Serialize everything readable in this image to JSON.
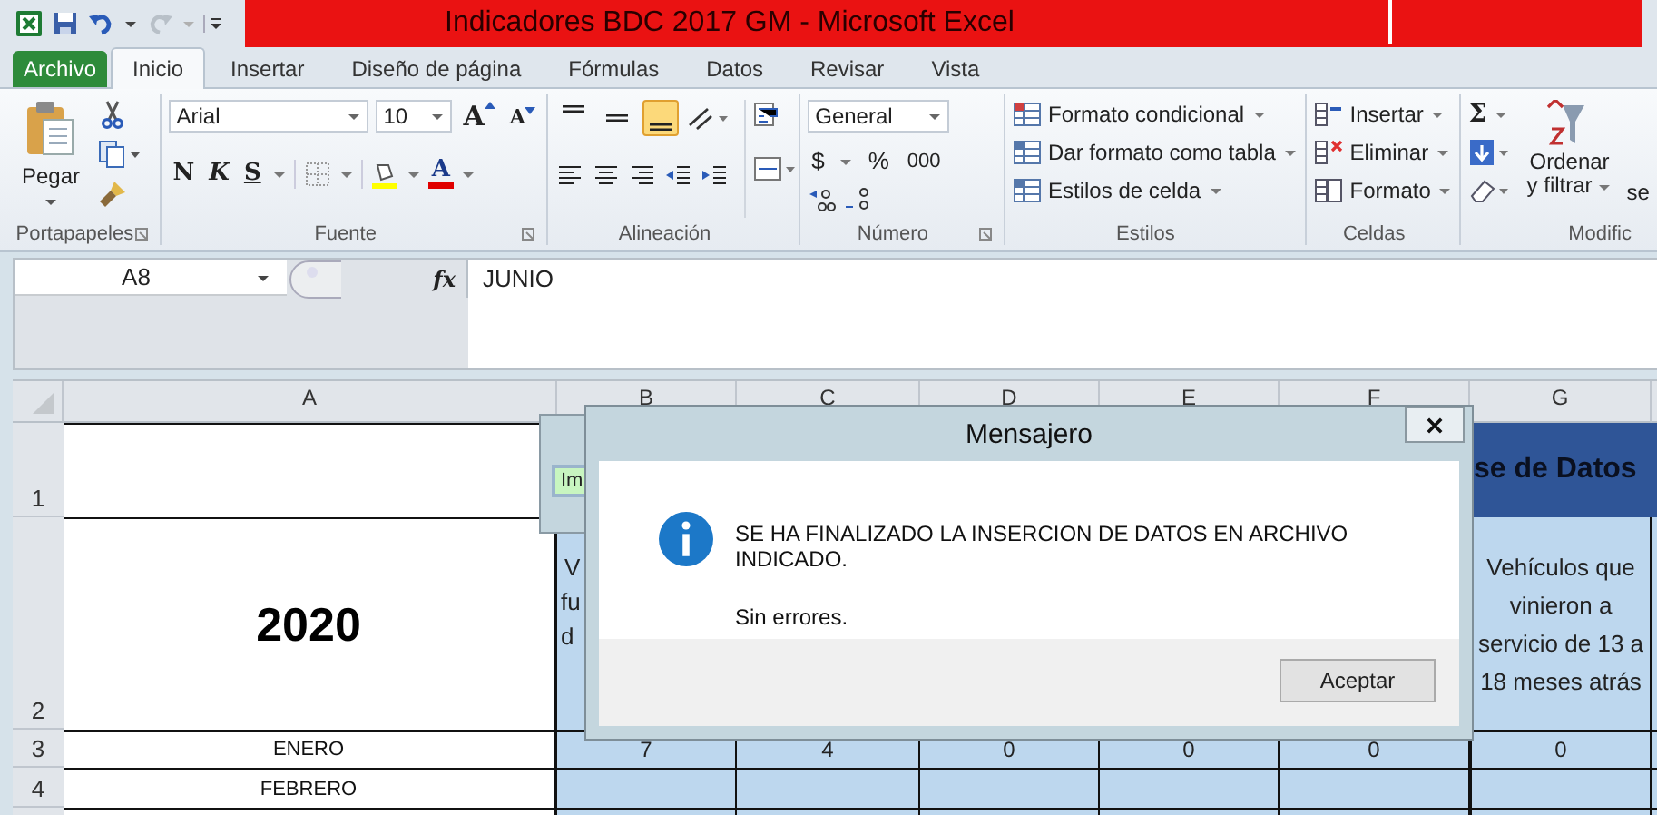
{
  "window": {
    "title": "Indicadores BDC 2017 GM  -  Microsoft Excel"
  },
  "tabs": [
    {
      "label": "Archivo",
      "kind": "file",
      "selected": false
    },
    {
      "label": "Inicio",
      "kind": "tab",
      "selected": true
    },
    {
      "label": "Insertar",
      "kind": "tab",
      "selected": false
    },
    {
      "label": "Diseño de página",
      "kind": "tab",
      "selected": false
    },
    {
      "label": "Fórmulas",
      "kind": "tab",
      "selected": false
    },
    {
      "label": "Datos",
      "kind": "tab",
      "selected": false
    },
    {
      "label": "Revisar",
      "kind": "tab",
      "selected": false
    },
    {
      "label": "Vista",
      "kind": "tab",
      "selected": false
    }
  ],
  "ribbon": {
    "clipboard": {
      "label": "Portapapeles",
      "paste": "Pegar"
    },
    "font": {
      "label": "Fuente",
      "font_name": "Arial",
      "font_size": "10",
      "grow": "A",
      "shrink": "A",
      "bold": "N",
      "italic": "K",
      "underline": "S",
      "font_color": "A"
    },
    "alignment": {
      "label": "Alineación",
      "vertical": [
        {
          "selected": false
        },
        {
          "selected": false
        },
        {
          "selected": true
        }
      ]
    },
    "number": {
      "label": "Número",
      "format": "General",
      "currency": "$",
      "percent": "%",
      "thousands": "000"
    },
    "styles": {
      "label": "Estilos",
      "items": [
        "Formato condicional",
        "Dar formato como tabla",
        "Estilos de celda"
      ]
    },
    "cells": {
      "label": "Celdas",
      "items": [
        "Insertar",
        "Eliminar",
        "Formato"
      ]
    },
    "editing": {
      "label": "Modific",
      "sigma": "Σ",
      "sort": [
        "Ordenar",
        "y filtrar"
      ],
      "cut_text": "se"
    }
  },
  "formula_bar": {
    "name_box": "A8",
    "fx": "fx",
    "value": "JUNIO"
  },
  "sheet": {
    "columns": [
      "A",
      "B",
      "C",
      "D",
      "E",
      "F",
      "G"
    ],
    "rows": [
      {
        "number": "1",
        "header": "se de Datos"
      },
      {
        "number": "2",
        "year": "2020",
        "b_fragments": [
          "V",
          "fu",
          "d"
        ],
        "g": "Vehículos que vinieron a servicio de 13 a 18 meses atrás"
      },
      {
        "number": "3",
        "month": "ENERO",
        "values": [
          "7",
          "4",
          "0",
          "0",
          "0",
          "0"
        ]
      },
      {
        "number": "4",
        "month": "FEBRERO"
      }
    ]
  },
  "background_window": {
    "label": "Im"
  },
  "dialog": {
    "title": "Mensajero",
    "message": "SE HA FINALIZADO LA INSERCION DE DATOS EN ARCHIVO INDICADO.",
    "detail": "Sin errores.",
    "button": "Aceptar"
  }
}
